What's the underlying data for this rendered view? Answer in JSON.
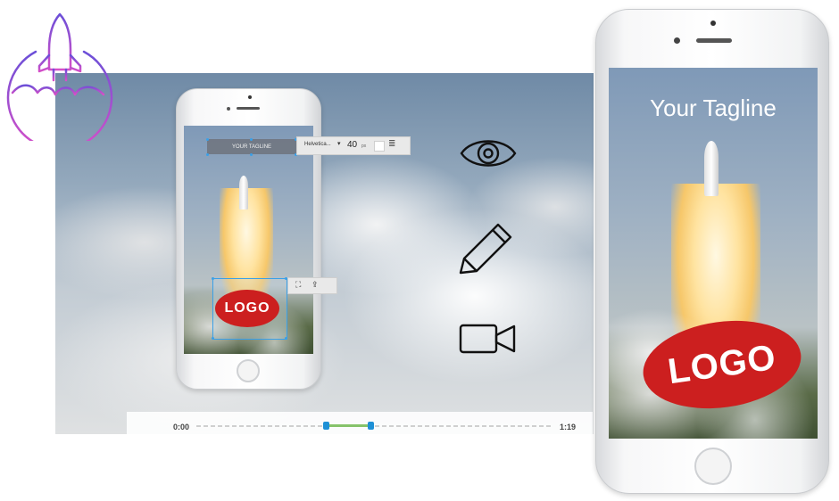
{
  "app_logo": {
    "icon": "rocket-icon",
    "color": "#a455d6"
  },
  "timeline": {
    "start_time": "0:00",
    "end_time": "1:19"
  },
  "small_phone": {
    "tagline_text": "YOUR TAGLINE",
    "font_name": "Helvetica...",
    "font_size": "40",
    "font_unit": "px",
    "logo_text": "LOGO"
  },
  "feature_icons": [
    "eye-icon",
    "pencil-icon",
    "video-camera-icon"
  ],
  "large_phone": {
    "tagline": "Your Tagline",
    "logo_text": "LOGO"
  },
  "colors": {
    "logo_red": "#cc1f1f",
    "accent_blue": "#1e90d6",
    "brand_purple": "#a455d6"
  }
}
